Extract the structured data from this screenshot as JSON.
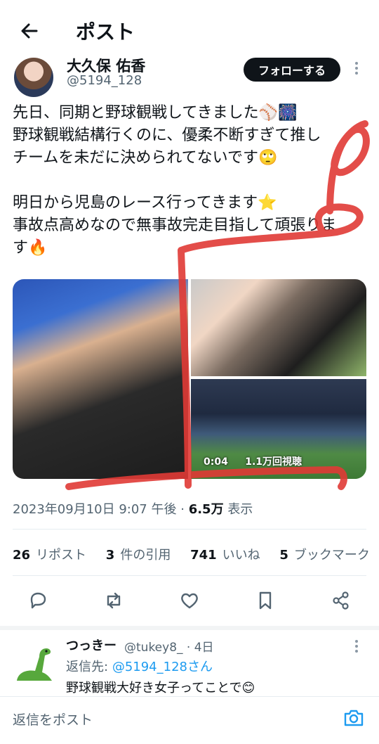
{
  "header": {
    "title": "ポスト"
  },
  "author": {
    "name": "大久保 佑香",
    "handle": "@5194_128",
    "follow_label": "フォローする"
  },
  "tweet": {
    "line1": "先日、同期と野球観戦してきました⚾🎆",
    "line2": "野球観戦結構行くのに、優柔不断すぎて推し",
    "line3": "チームを未だに決められてないです🙄",
    "line4": "明日から児島のレース行ってきます⭐",
    "line5": "事故点高めなので無事故完走目指して頑張りま",
    "line6": "す🔥"
  },
  "media": {
    "video_time": "0:04",
    "video_views": "1.1万回視聴"
  },
  "meta": {
    "datetime": "2023年09月10日 9:07 午後",
    "separator": "·",
    "views_count": "6.5万",
    "views_label": "表示"
  },
  "stats": {
    "reposts_count": "26",
    "reposts_label": "リポスト",
    "quotes_count": "3",
    "quotes_label": "件の引用",
    "likes_count": "741",
    "likes_label": "いいね",
    "bookmarks_count": "5",
    "bookmarks_label": "ブックマーク"
  },
  "reply": {
    "name": "つっきー",
    "handle_time": "@tukey8_ · 4日",
    "to_label": "返信先:",
    "to_handle": "@5194_128さん",
    "text": "野球観戦大好き女子ってことで😊"
  },
  "composer": {
    "placeholder": "返信をポスト"
  },
  "colors": {
    "accent": "#1d9bf0",
    "scribble": "#e03a35",
    "text": "#0f1419",
    "muted": "#536471"
  }
}
